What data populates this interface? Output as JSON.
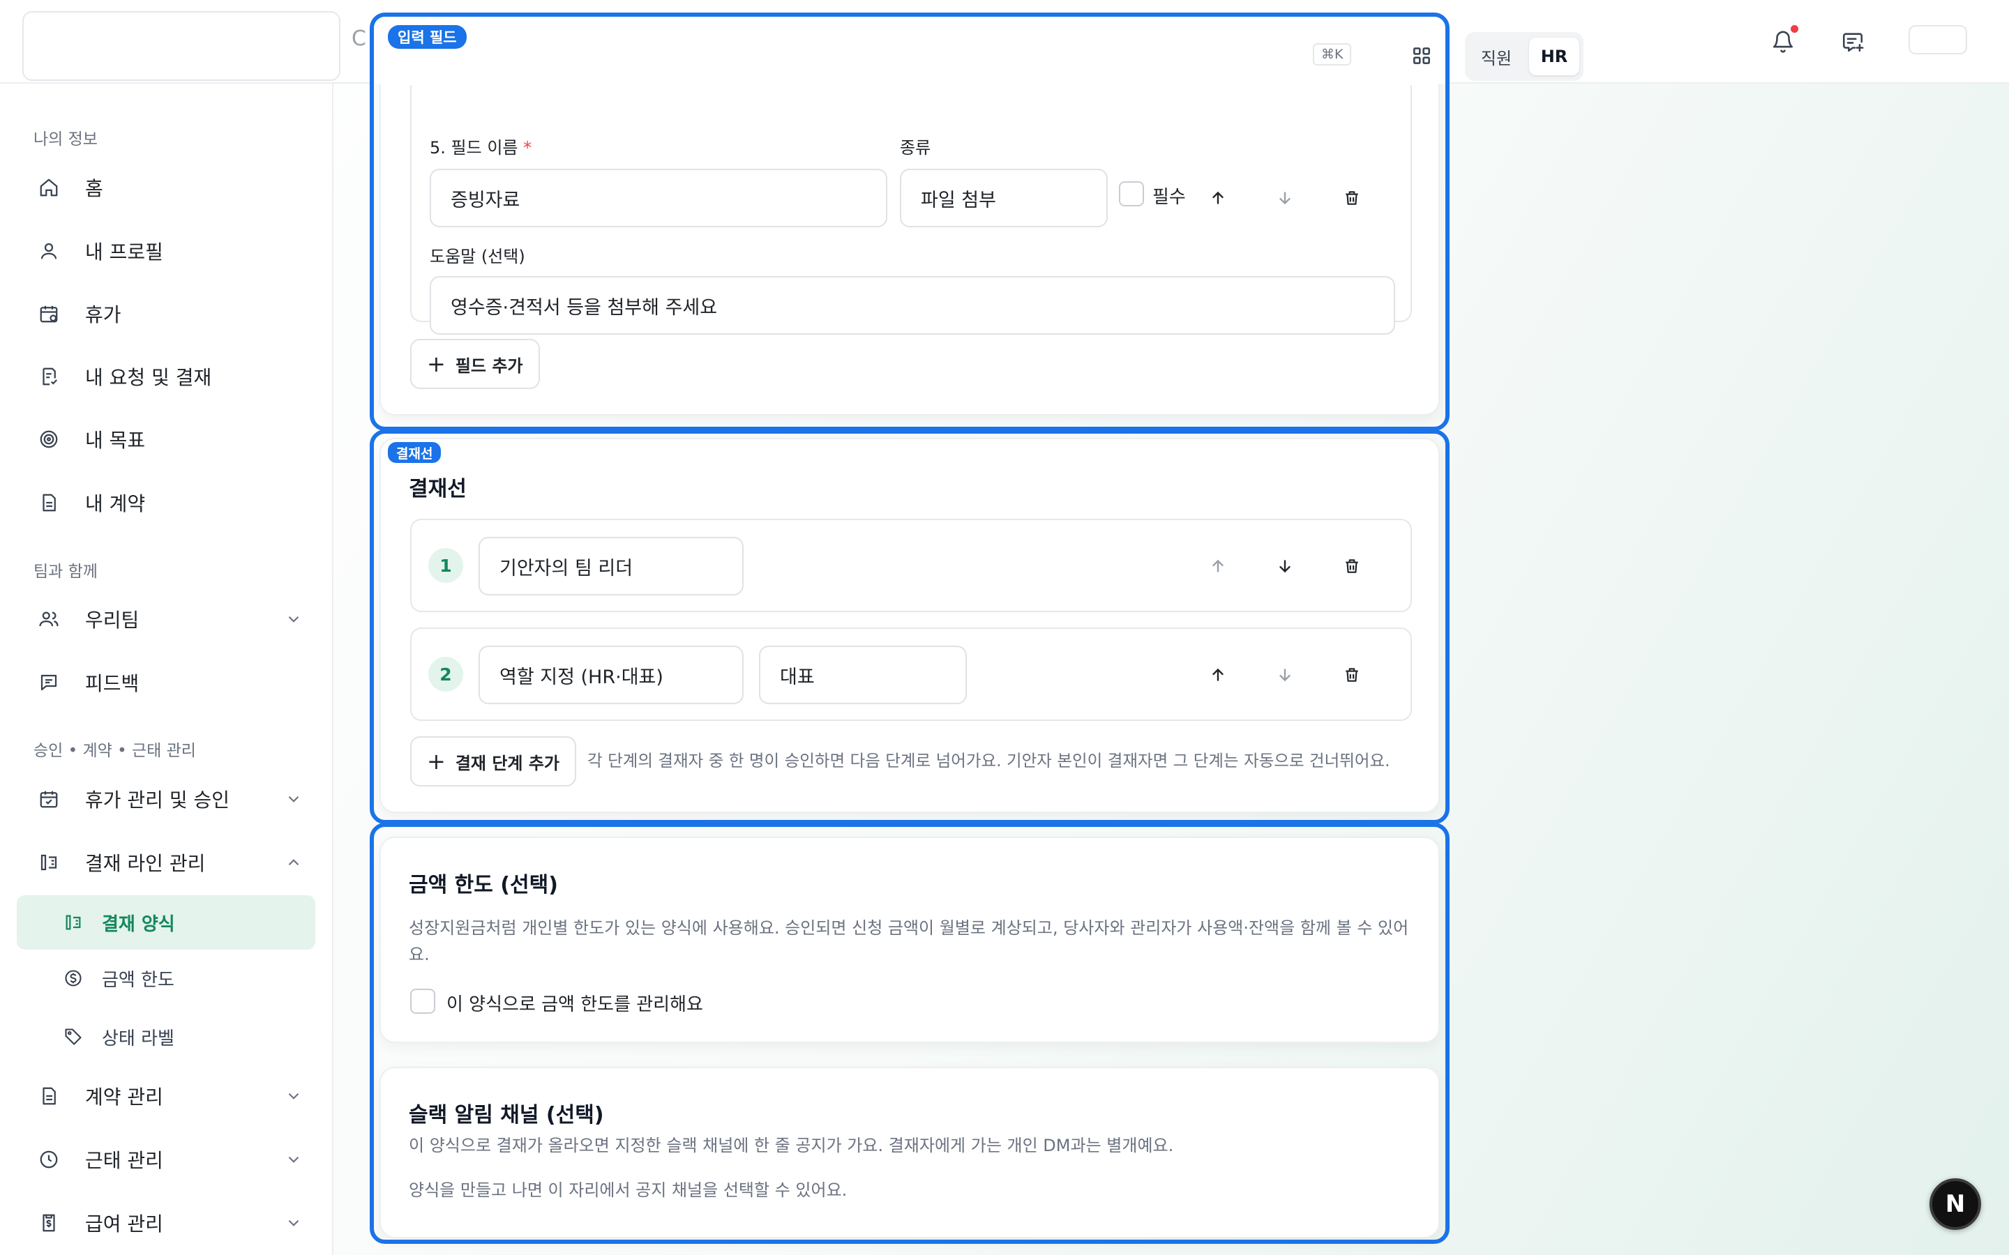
{
  "topbar": {
    "search_fragment": "C",
    "shortcut": "⌘K",
    "roles": {
      "employee": "직원",
      "hr": "HR"
    }
  },
  "sidebar": {
    "section_my": "나의 정보",
    "items_my": [
      {
        "label": "홈",
        "icon": "home-icon"
      },
      {
        "label": "내 프로필",
        "icon": "user-icon"
      },
      {
        "label": "휴가",
        "icon": "calendar-icon"
      },
      {
        "label": "내 요청 및 결재",
        "icon": "request-icon"
      },
      {
        "label": "내 목표",
        "icon": "target-icon"
      },
      {
        "label": "내 계약",
        "icon": "document-icon"
      }
    ],
    "section_team": "팀과 함께",
    "items_team": [
      {
        "label": "우리팀",
        "icon": "team-icon"
      },
      {
        "label": "피드백",
        "icon": "feedback-icon"
      }
    ],
    "section_admin": "승인 • 계약 • 근태 관리",
    "items_admin": [
      {
        "label": "휴가 관리 및 승인",
        "icon": "calendar-check-icon"
      },
      {
        "label": "결재 라인 관리",
        "icon": "approval-line-icon"
      }
    ],
    "sub_items": [
      {
        "label": "결재 양식",
        "icon": "form-icon",
        "active": true
      },
      {
        "label": "금액 한도",
        "icon": "dollar-icon"
      },
      {
        "label": "상태 라벨",
        "icon": "tag-icon"
      }
    ],
    "items_bottom": [
      {
        "label": "계약 관리",
        "icon": "contract-icon"
      },
      {
        "label": "근태 관리",
        "icon": "clock-icon"
      },
      {
        "label": "급여 관리",
        "icon": "payroll-icon"
      }
    ]
  },
  "fields_card": {
    "field_label": "5. 필드 이름",
    "required_mark": "*",
    "type_label": "종류",
    "field_name_value": "증빙자료",
    "type_value": "파일 첨부",
    "required_checkbox_label": "필수",
    "help_label": "도움말 (선택)",
    "help_value": "영수증·견적서 등을 첨부해 주세요",
    "add_field_label": "필드 추가"
  },
  "approval_card": {
    "title": "결재선",
    "steps": [
      {
        "number": "1",
        "approver": "기안자의 팀 리더",
        "role": ""
      },
      {
        "number": "2",
        "approver": "역할 지정 (HR·대표)",
        "role": "대표"
      }
    ],
    "add_step_label": "결재 단계 추가",
    "hint": "각 단계의 결재자 중 한 명이 승인하면 다음 단계로 넘어가요. 기안자 본인이 결재자면 그 단계는 자동으로 건너뛰어요."
  },
  "limit_card": {
    "title": "금액 한도 (선택)",
    "description": "성장지원금처럼 개인별 한도가 있는 양식에 사용해요. 승인되면 신청 금액이 월별로 계상되고, 당사자와 관리자가 사용액·잔액을 함께 볼 수 있어요.",
    "checkbox_label": "이 양식으로 금액 한도를 관리해요"
  },
  "slack_card": {
    "title": "슬랙 알림 채널 (선택)",
    "description": "이 양식으로 결재가 올라오면 지정한 슬랙 채널에 한 줄 공지가 가요. 결재자에게 가는 개인 DM과는 별개예요.",
    "note": "양식을 만들고 나면 이 자리에서 공지 채널을 선택할 수 있어요."
  },
  "highlights": {
    "input_fields": "입력 필드",
    "approval_line": "결재선"
  },
  "fab_label": "N",
  "colors": {
    "accent_green": "#13875d",
    "highlight_blue": "#1a73e8",
    "required_red": "#ef4444"
  }
}
